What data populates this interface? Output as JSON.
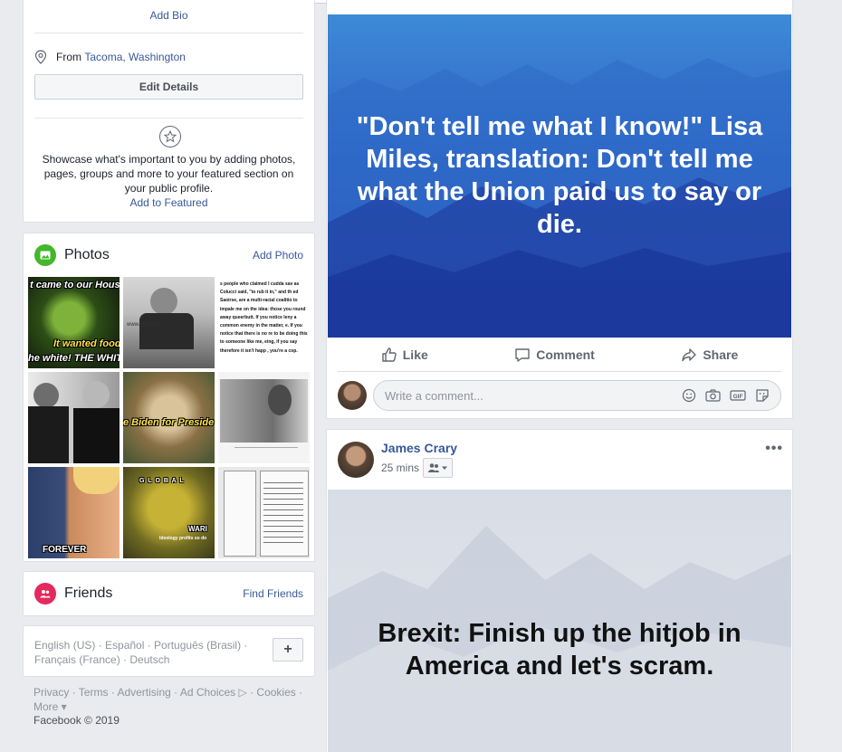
{
  "intro": {
    "add_bio": "Add Bio",
    "from_prefix": "From ",
    "from_place": "Tacoma, Washington",
    "edit_details": "Edit Details",
    "showcase_text": "Showcase what's important to you by adding photos, pages, groups and more to your featured section on your public profile.",
    "add_to_featured": "Add to Featured"
  },
  "photos": {
    "title": "Photos",
    "add_photo": "Add Photo",
    "captions": {
      "p1_top": "t came to our House",
      "p1_mid": "It wanted food",
      "p1_bot": "he white!  THE WHITE",
      "p2_small": "www.cnn.com",
      "p3_text": "s people who claimed I cudda sav as Colucci said, \"to rub it in,\" and th ed Saoirse, are a multi-racial coalitio to impale me on the idea: those you round away queerbutt. If you notice leny a common enemy in the matter, e. If you notice that there is no re to be doing this to someone like me, eing, if you say therefore it isn't happ , you're a cop.",
      "p5_text": "e Biden for Preside",
      "p7_text": "FOREVER",
      "p8_top": "G L O B A L",
      "p8_mid": "WARI",
      "p8_bot": "Ideology profits so do"
    }
  },
  "friends": {
    "title": "Friends",
    "find_friends": "Find Friends"
  },
  "languages": {
    "list": "English (US) · Español · Português (Brasil) · Français (France) · Deutsch",
    "plus": "+"
  },
  "footer": {
    "links": "Privacy · Terms · Advertising · Ad Choices ▷ · Cookies · More ▾",
    "copyright": "Facebook © 2019"
  },
  "post1": {
    "text": "\"Don't tell me what I know!\" Lisa Miles, translation: Don't tell me what the Union paid us to say or die.",
    "like": "Like",
    "comment": "Comment",
    "share": "Share",
    "comment_placeholder": "Write a comment..."
  },
  "post2": {
    "author": "James Crary",
    "time": "25 mins",
    "more": "•••",
    "text": "Brexit: Finish up the hitjob in America and let's scram."
  },
  "colors": {
    "link": "#385898",
    "photos_icon": "#42b72a",
    "friends_icon": "#e4295e",
    "post1_bg": "#2f63c9",
    "post2_bg": "#dfe3ea"
  }
}
